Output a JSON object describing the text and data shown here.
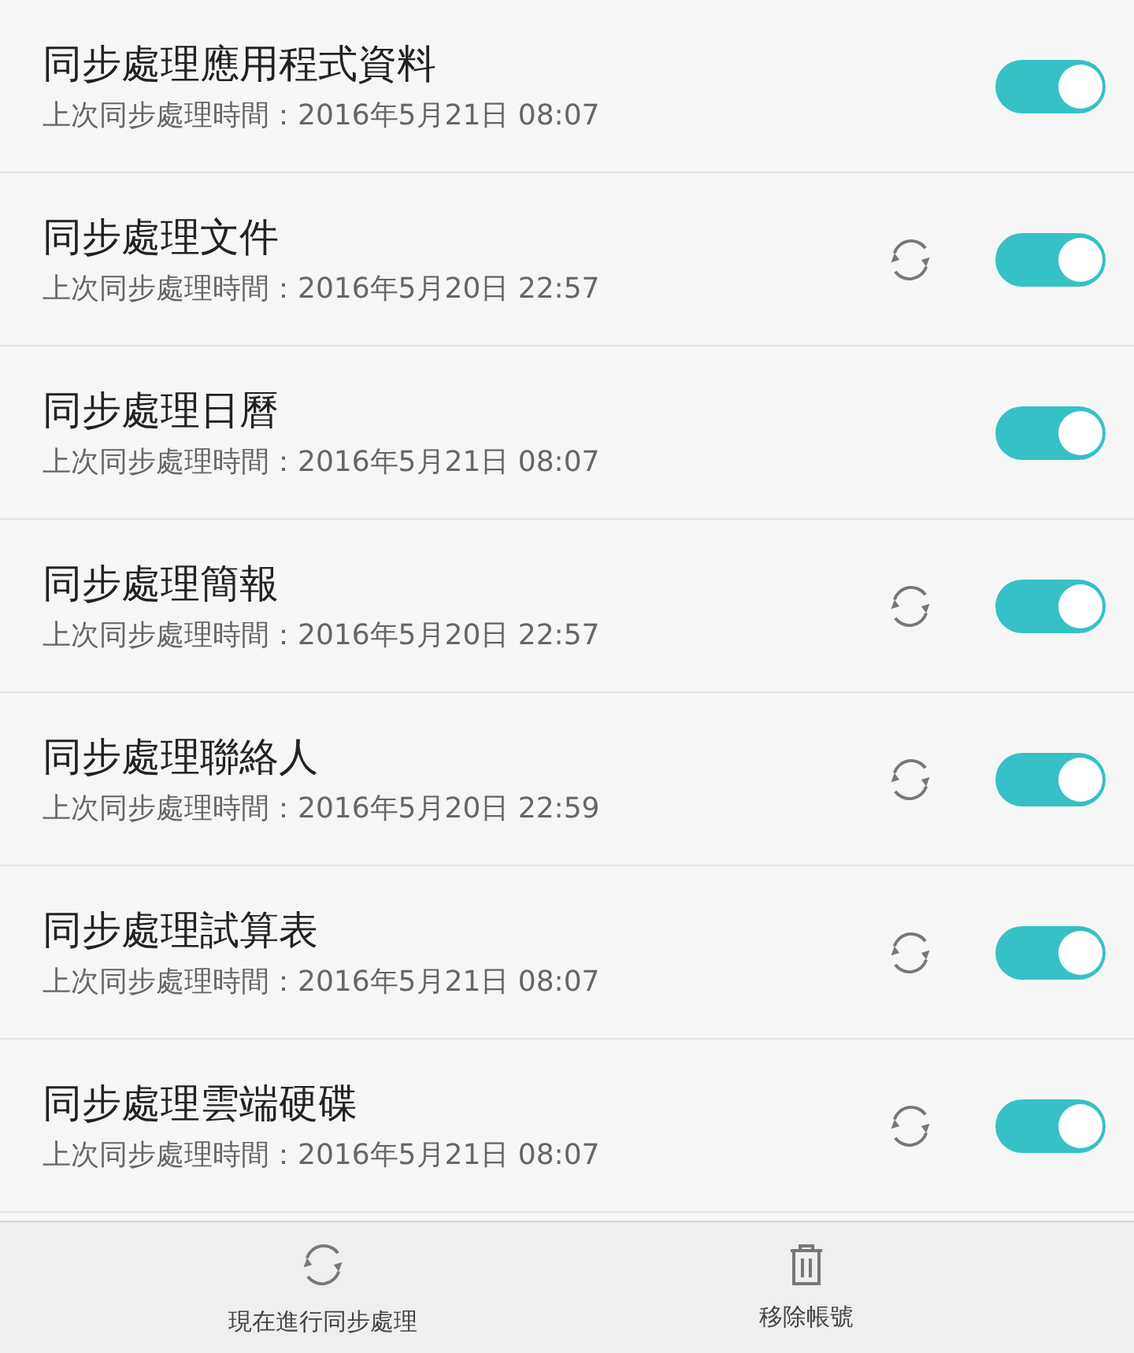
{
  "sync_items": [
    {
      "title": "同步處理應用程式資料",
      "subtitle": "上次同步處理時間：2016年5月21日 08:07",
      "syncing": false,
      "on": true
    },
    {
      "title": "同步處理文件",
      "subtitle": "上次同步處理時間：2016年5月20日 22:57",
      "syncing": true,
      "on": true
    },
    {
      "title": "同步處理日曆",
      "subtitle": "上次同步處理時間：2016年5月21日 08:07",
      "syncing": false,
      "on": true
    },
    {
      "title": "同步處理簡報",
      "subtitle": "上次同步處理時間：2016年5月20日 22:57",
      "syncing": true,
      "on": true
    },
    {
      "title": "同步處理聯絡人",
      "subtitle": "上次同步處理時間：2016年5月20日 22:59",
      "syncing": true,
      "on": true
    },
    {
      "title": "同步處理試算表",
      "subtitle": "上次同步處理時間：2016年5月21日 08:07",
      "syncing": true,
      "on": true
    },
    {
      "title": "同步處理雲端硬碟",
      "subtitle": "上次同步處理時間：2016年5月21日 08:07",
      "syncing": true,
      "on": true
    }
  ],
  "bottom_actions": [
    {
      "kind": "sync",
      "label": "現在進行同步處理"
    },
    {
      "kind": "delete",
      "label": "移除帳號"
    }
  ]
}
